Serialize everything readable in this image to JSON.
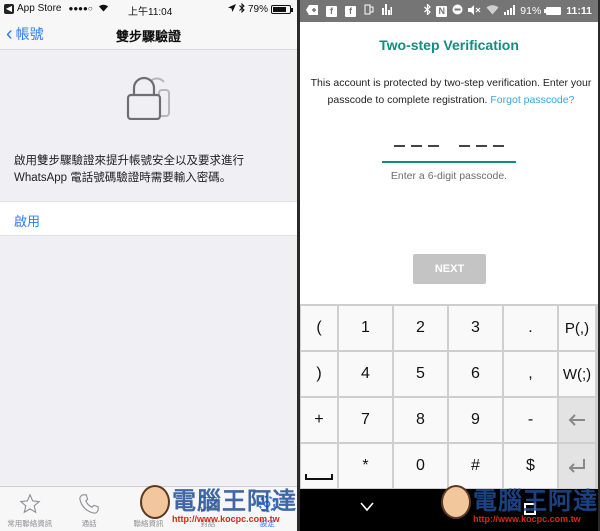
{
  "ios": {
    "status": {
      "back_app": "App Store",
      "signal_dots": "●●●●○",
      "time": "上午11:04",
      "battery_percent": "79%",
      "battery_level": 0.79
    },
    "nav": {
      "back_label": "帳號",
      "title": "雙步驟驗證"
    },
    "description": "啟用雙步驟驗證來提升帳號安全以及要求進行 WhatsApp 電話號碼驗證時需要輸入密碼。",
    "enable_label": "啟用",
    "tabs": [
      {
        "label": "常用聯絡資訊",
        "icon": "star-icon",
        "active": false
      },
      {
        "label": "通話",
        "icon": "phone-icon",
        "active": false
      },
      {
        "label": "聯絡資訊",
        "icon": "contacts-icon",
        "active": false
      },
      {
        "label": "對話",
        "icon": "chats-icon",
        "active": false
      },
      {
        "label": "設定",
        "icon": "settings-icon",
        "active": true
      }
    ],
    "accent_color": "#2f7bf5"
  },
  "android": {
    "status": {
      "battery_percent": "91%",
      "time": "11:11",
      "fb_glyph": "f",
      "nfc_glyph": "N"
    },
    "title": "Two-step Verification",
    "description": "This account is protected by two-step verification. Enter your passcode to complete registration.",
    "forgot_link": "Forgot passcode?",
    "passcode_hint": "Enter a 6-digit passcode.",
    "next_label": "NEXT",
    "keyboard": {
      "keys": [
        "(",
        "1",
        "2",
        "3",
        ".",
        "P(,)",
        ")",
        "4",
        "5",
        "6",
        ",",
        "W(;)",
        "+",
        "7",
        "8",
        "9",
        "-",
        "←",
        "␣",
        "*",
        "0",
        "#",
        "$",
        "↵"
      ]
    },
    "accent_color": "#128c7e",
    "link_color": "#34a8e8"
  },
  "watermark": {
    "title": "電腦王阿達",
    "url": "http://www.kocpc.com.tw"
  }
}
